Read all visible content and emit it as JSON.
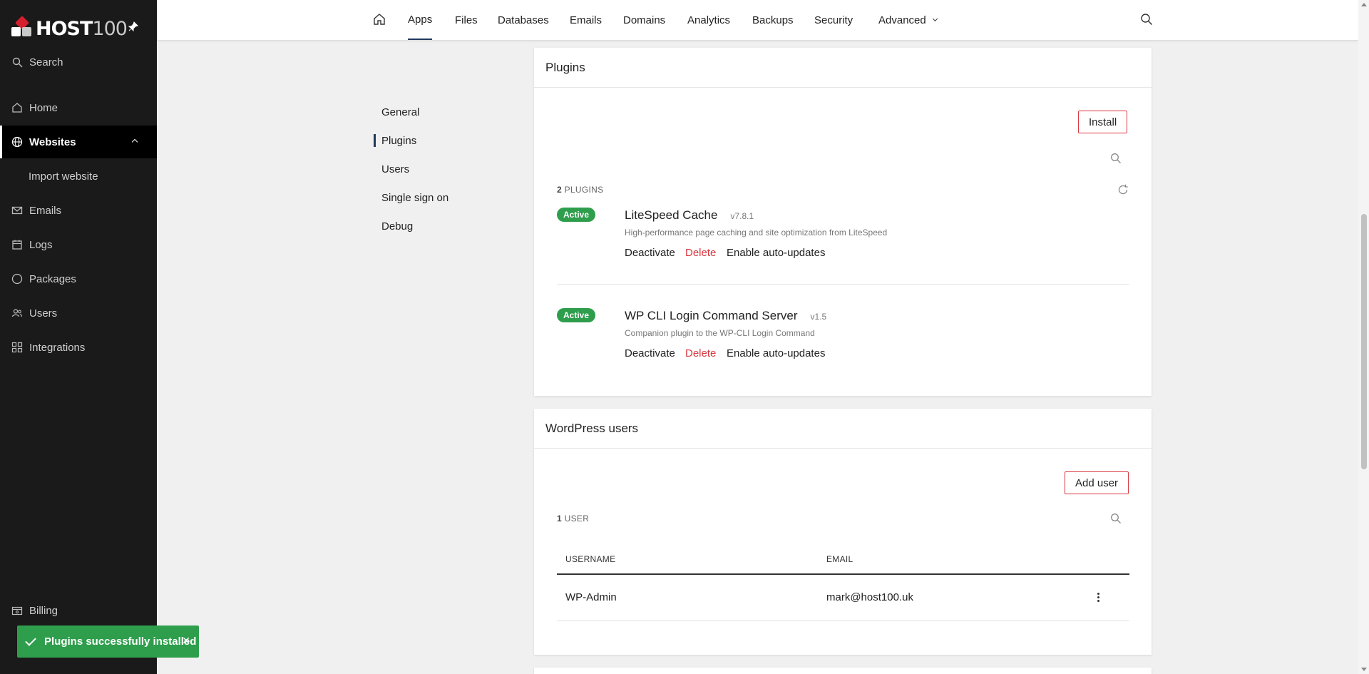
{
  "sidebar": {
    "logo": {
      "brand": "HOST",
      "brand_num": "100"
    },
    "search": "Search",
    "items": [
      {
        "label": "Home",
        "icon": "home-icon"
      },
      {
        "label": "Websites",
        "icon": "globe-icon"
      },
      {
        "label": "Import website"
      },
      {
        "label": "Emails",
        "icon": "mail-icon"
      },
      {
        "label": "Logs",
        "icon": "calendar-icon"
      },
      {
        "label": "Packages",
        "icon": "circle-icon"
      },
      {
        "label": "Users",
        "icon": "users-icon"
      },
      {
        "label": "Integrations",
        "icon": "grid-icon"
      },
      {
        "label": "Billing",
        "icon": "billing-icon"
      }
    ]
  },
  "topnav": {
    "tabs": [
      "Apps",
      "Files",
      "Databases",
      "Emails",
      "Domains",
      "Analytics",
      "Backups",
      "Security",
      "Advanced"
    ],
    "active": "Apps"
  },
  "submenu": {
    "items": [
      "General",
      "Plugins",
      "Users",
      "Single sign on",
      "Debug"
    ],
    "active": "Plugins"
  },
  "plugins_card": {
    "title": "Plugins",
    "install_label": "Install",
    "count_num": "2",
    "count_label": "PLUGINS",
    "plugins": [
      {
        "status": "Active",
        "name": "LiteSpeed Cache",
        "version": "v7.8.1",
        "description": "High-performance page caching and site optimization from LiteSpeed",
        "actions": [
          "Deactivate",
          "Delete",
          "Enable auto-updates"
        ]
      },
      {
        "status": "Active",
        "name": "WP CLI Login Command Server",
        "version": "v1.5",
        "description": "Companion plugin to the WP-CLI Login Command",
        "actions": [
          "Deactivate",
          "Delete",
          "Enable auto-updates"
        ]
      }
    ]
  },
  "users_card": {
    "title": "WordPress users",
    "add_label": "Add user",
    "count_num": "1",
    "count_label": "USER",
    "columns": [
      "USERNAME",
      "EMAIL"
    ],
    "rows": [
      {
        "username": "WP-Admin",
        "email": "mark@host100.uk"
      }
    ]
  },
  "toast": {
    "message": "Plugins successfully installed"
  },
  "colors": {
    "accent": "#d9373f",
    "success": "#2e9e4c",
    "sidebar": "#1a1a1a",
    "nav_active": "#1f3a5f"
  }
}
